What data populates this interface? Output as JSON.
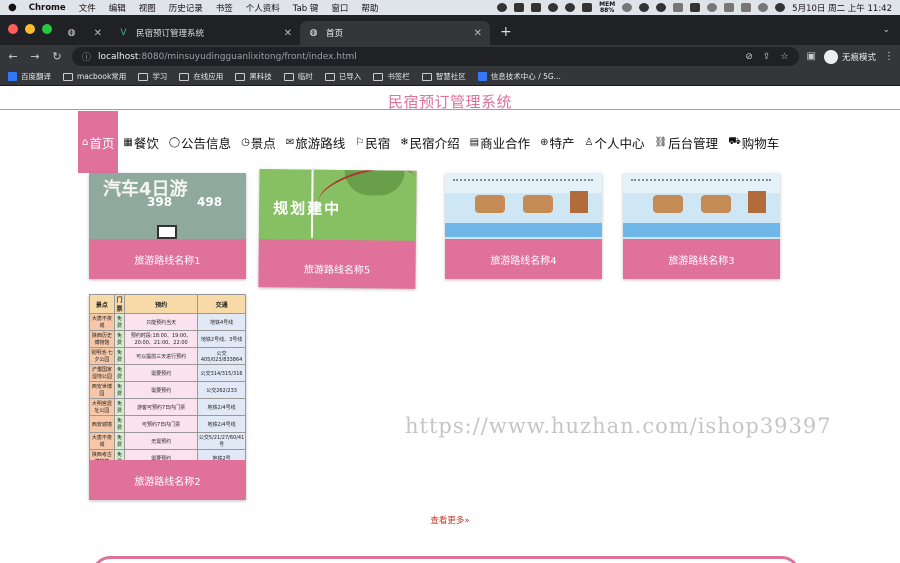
{
  "menubar": {
    "app": "Chrome",
    "items": [
      "文件",
      "编辑",
      "视图",
      "历史记录",
      "书签",
      "个人资料",
      "Tab 键",
      "窗口",
      "帮助"
    ],
    "mem_top": "MEM",
    "mem_val": "88%",
    "clock": "5月10日 周二 上午 11:42"
  },
  "tabs": [
    {
      "title": "民宿预订管理系统",
      "active": false
    },
    {
      "title": "首页",
      "active": true
    }
  ],
  "address": {
    "host": "localhost",
    "path": ":8080/minsuyudingguanlixitong/front/index.html"
  },
  "toolbar": {
    "incognito": "无痕模式"
  },
  "bookmarks": [
    "百度翻译",
    "macbook常用",
    "学习",
    "在线应用",
    "黑科技",
    "临时",
    "已导入",
    "书签栏",
    "智慧社区",
    "信息技术中心 / 5G..."
  ],
  "site": {
    "title": "民宿预订管理系统",
    "nav": [
      {
        "label": "首页",
        "icon": "⌂",
        "active": true
      },
      {
        "label": "餐饮",
        "icon": "▦",
        "active": false
      },
      {
        "label": "公告信息",
        "icon": "◯",
        "active": false
      },
      {
        "label": "景点",
        "icon": "◷",
        "active": false
      },
      {
        "label": "旅游路线",
        "icon": "✉",
        "active": false
      },
      {
        "label": "民宿",
        "icon": "⚐",
        "active": false
      },
      {
        "label": "民宿介绍",
        "icon": "❄",
        "active": false
      },
      {
        "label": "商业合作",
        "icon": "▤",
        "active": false
      },
      {
        "label": "特产",
        "icon": "⊕",
        "active": false
      },
      {
        "label": "个人中心",
        "icon": "♙",
        "active": false
      },
      {
        "label": "后台管理",
        "icon": "⛓",
        "active": false
      },
      {
        "label": "购物车",
        "icon": "⛟",
        "active": false
      }
    ],
    "cards": [
      {
        "label": "旅游路线名称1",
        "poster_big": "汽车4日游",
        "price_a": "398",
        "price_b": "498"
      },
      {
        "label": "旅游路线名称5",
        "map_text": "规划建中"
      },
      {
        "label": "旅游路线名称4"
      },
      {
        "label": "旅游路线名称3"
      },
      {
        "label": "旅游路线名称2"
      }
    ],
    "table": {
      "headers": [
        "景点",
        "门票",
        "预约",
        "交通"
      ],
      "rows": [
        [
          "大唐不夜城",
          "免费",
          "只能预约当天",
          "地铁4号线"
        ],
        [
          "陕西历史博物馆",
          "免费",
          "预约时段:18:00、19:00、20:00、21:00、22:00",
          "地铁2号线、3号线"
        ],
        [
          "昆明池·七夕公园",
          "免费",
          "可以提前三天进行预约",
          "公交405/023/833864"
        ],
        [
          "浐灞国家湿地公园",
          "免费",
          "需要预约",
          "公交314/315/316"
        ],
        [
          "西安世博园",
          "免费",
          "需要预约",
          "公交262/233"
        ],
        [
          "大明宫遗址公园",
          "免费",
          "游客可预约7日内门票",
          "地铁2/4号线"
        ],
        [
          "西安城墙",
          "免费",
          "可预约7日内门票",
          "地铁2/4号线"
        ],
        [
          "大唐不夜城",
          "免费",
          "无需预约",
          "公交5/21/27/60/41号"
        ],
        [
          "陕西考古博物馆",
          "免费",
          "需要预约",
          "地铁2号"
        ]
      ]
    },
    "watermark": "https://www.huzhan.com/ishop39397",
    "more_link": "查看更多»"
  },
  "colors": {
    "accent": "#e0719b",
    "chrome_dark": "#202124",
    "chrome_mid": "#35363a"
  }
}
